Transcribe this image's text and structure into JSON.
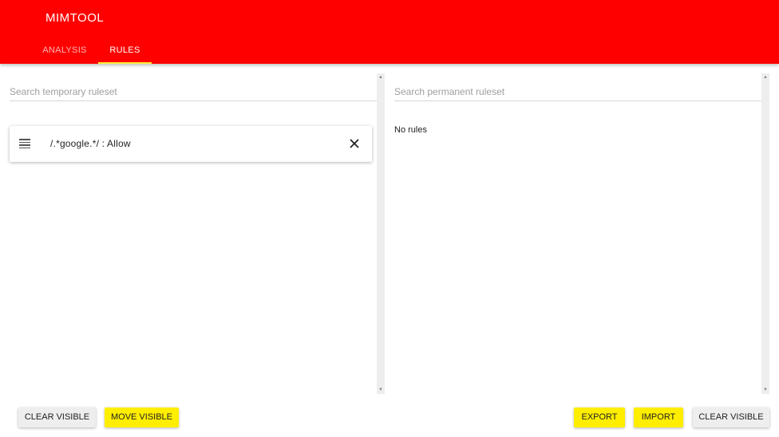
{
  "app": {
    "title": "MIMTOOL"
  },
  "tabs": [
    {
      "label": "ANALYSIS",
      "active": false
    },
    {
      "label": "RULES",
      "active": true
    }
  ],
  "temporary": {
    "search_placeholder": "Search temporary ruleset",
    "rules": [
      {
        "text": "/.*google.*/ : Allow"
      }
    ]
  },
  "permanent": {
    "search_placeholder": "Search permanent ruleset",
    "empty_text": "No rules"
  },
  "buttons": {
    "clear_visible_left": "CLEAR VISIBLE",
    "move_visible": "MOVE VISIBLE",
    "export": "EXPORT",
    "import": "IMPORT",
    "clear_visible_right": "CLEAR VISIBLE"
  },
  "icons": {
    "drag": "drag-handle-icon",
    "close": "close-icon",
    "scroll_up": "chevron-up-icon",
    "scroll_down": "chevron-down-icon"
  },
  "colors": {
    "appbar": "#ff0000",
    "accent": "#ffee00",
    "tab_indicator": "#ffeb3b",
    "neutral_button": "#eeeeee"
  }
}
